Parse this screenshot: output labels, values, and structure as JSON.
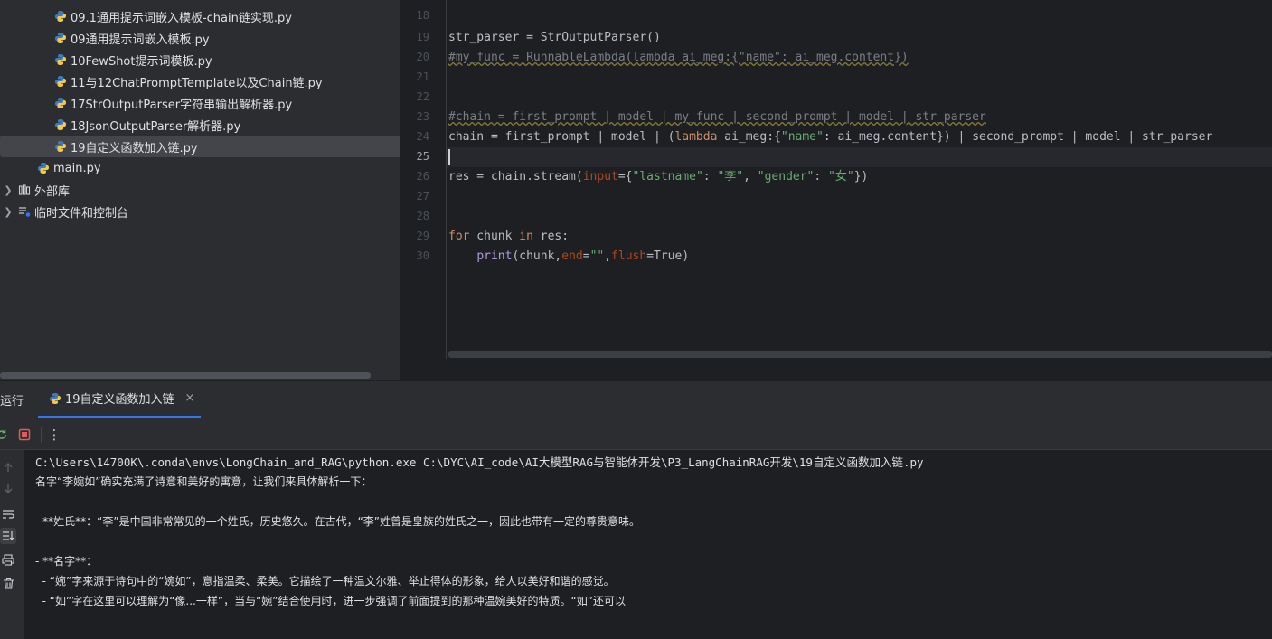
{
  "project_tree": {
    "files": [
      {
        "name": "09.1通用提示词嵌入模板-chain链实现.py"
      },
      {
        "name": "09通用提示词嵌入模板.py"
      },
      {
        "name": "10FewShot提示词模板.py"
      },
      {
        "name": "11与12ChatPromptTemplate以及Chain链.py"
      },
      {
        "name": "17StrOutputParser字符串输出解析器.py"
      },
      {
        "name": "18JsonOutputParser解析器.py"
      },
      {
        "name": "19自定义函数加入链.py"
      }
    ],
    "main_file": "main.py",
    "external_libraries": "外部库",
    "scratches": "临时文件和控制台",
    "icons": {
      "python": "python-file-icon",
      "library": "library-icon",
      "scratch": "scratch-icon",
      "expand": "chevron-right-icon"
    }
  },
  "editor": {
    "line_numbers": [
      "18",
      "19",
      "20",
      "21",
      "22",
      "23",
      "24",
      "25",
      "26",
      "27",
      "28",
      "29",
      "30"
    ],
    "current_line": "25",
    "code": {
      "l19_text": "str_parser = StrOutputParser()",
      "l20_text": "#my_func = RunnableLambda(lambda ai_meg:{\"name\": ai_meg.content})",
      "l23_text": "#chain = first_prompt | model | my_func | second_prompt | model | str_parser",
      "l24_a": "chain = first_prompt | model | (",
      "l24_kw": "lambda",
      "l24_b": " ai_meg:{",
      "l24_str": "\"name\"",
      "l24_c": ": ai_meg.content}) | second_prompt | model | str_parser",
      "l26_a": "res = chain.stream(",
      "l26_param": "input",
      "l26_b": "={",
      "l26_s1": "\"lastname\"",
      "l26_c": ": ",
      "l26_s2": "\"李\"",
      "l26_d": ", ",
      "l26_s3": "\"gender\"",
      "l26_e": ": ",
      "l26_s4": "\"女\"",
      "l26_f": "})",
      "l29_kw1": "for",
      "l29_a": " chunk ",
      "l29_kw2": "in",
      "l29_b": " res:",
      "l30_indent": "    ",
      "l30_fn": "print",
      "l30_a": "(chunk,",
      "l30_p1": "end",
      "l30_b": "=",
      "l30_s": "\"\"",
      "l30_c": ",",
      "l30_p2": "flush",
      "l30_d": "=True)"
    }
  },
  "run_window": {
    "title": "运行",
    "tab_label": "19自定义函数加入链",
    "tab_close": "×",
    "toolbar": {
      "rerun_icon": "rerun-icon",
      "stop_icon": "stop-icon",
      "more": "⋮"
    },
    "side_icons": [
      "arrow-up-icon",
      "arrow-down-icon",
      "soft-wrap-icon",
      "scroll-to-end-icon",
      "print-icon",
      "trash-icon"
    ],
    "console_lines": [
      "C:\\Users\\14700K\\.conda\\envs\\LongChain_and_RAG\\python.exe C:\\DYC\\AI_code\\AI大模型RAG与智能体开发\\P3_LangChainRAG开发\\19自定义函数加入链.py",
      "名字“李婉如”确实充满了诗意和美好的寓意，让我们来具体解析一下：",
      "",
      "- **姓氏**：“李”是中国非常常见的一个姓氏，历史悠久。在古代，“李”姓曾是皇族的姓氏之一，因此也带有一定的尊贵意味。",
      "",
      "- **名字**：",
      "  - “婉”字来源于诗句中的“婉如”，意指温柔、柔美。它描绘了一种温文尔雅、举止得体的形象，给人以美好和谐的感觉。",
      "  - “如”字在这里可以理解为“像...一样”，当与“婉”结合使用时，进一步强调了前面提到的那种温婉美好的特质。“如”还可以"
    ]
  }
}
